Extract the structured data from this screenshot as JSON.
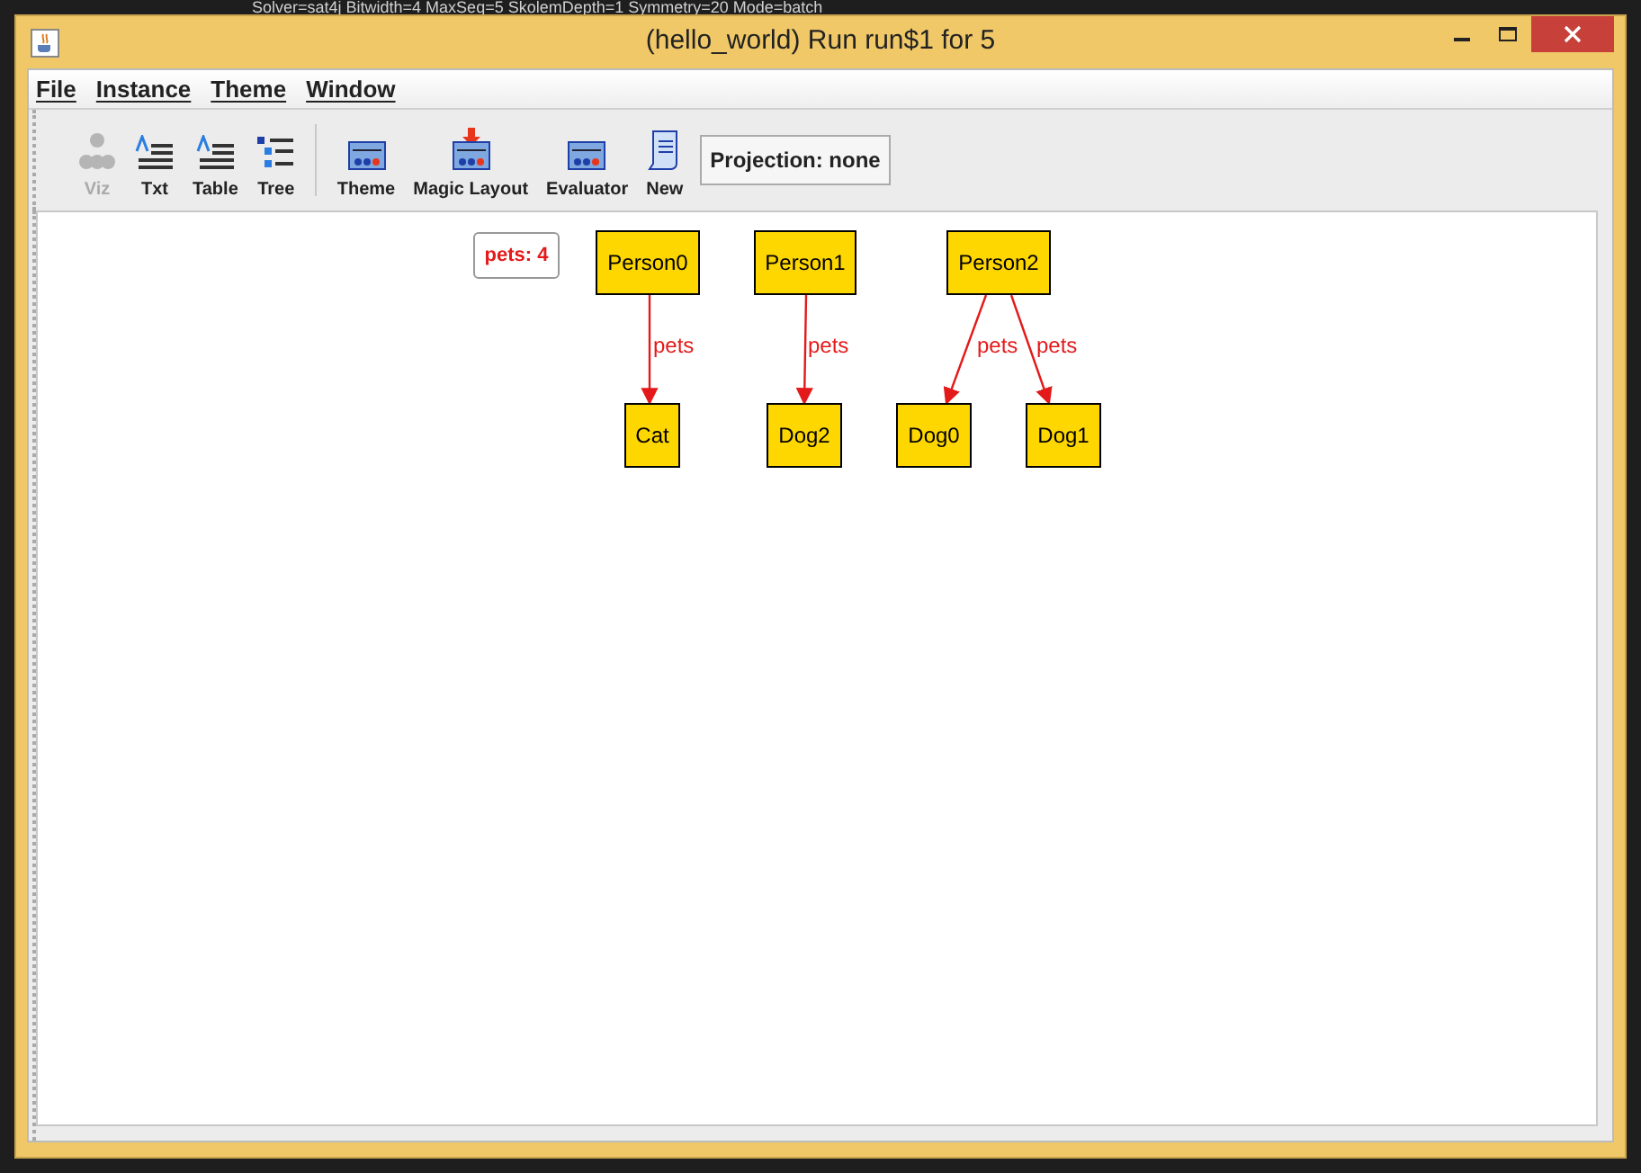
{
  "background_console": {
    "text": "Solver=sat4j Bitwidth=4 MaxSeq=5 SkolemDepth=1 Symmetry=20 Mode=batch"
  },
  "window": {
    "title": "(hello_world) Run run$1 for 5"
  },
  "menu": [
    "File",
    "Instance",
    "Theme",
    "Window"
  ],
  "toolbar": [
    {
      "label": "Viz",
      "kind": "viz",
      "disabled": true
    },
    {
      "label": "Txt",
      "kind": "txt",
      "disabled": false
    },
    {
      "label": "Table",
      "kind": "table",
      "disabled": false
    },
    {
      "label": "Tree",
      "kind": "tree",
      "disabled": false
    },
    {
      "label": "Theme",
      "kind": "panel",
      "disabled": false
    },
    {
      "label": "Magic Layout",
      "kind": "magic",
      "disabled": false
    },
    {
      "label": "Evaluator",
      "kind": "panel",
      "disabled": false
    },
    {
      "label": "New",
      "kind": "scroll",
      "disabled": false
    }
  ],
  "projection": "Projection: none",
  "graph": {
    "legend": "pets: 4",
    "nodes": [
      {
        "label": "Person0",
        "children": [
          {
            "label": "Cat",
            "edge": "pets"
          }
        ]
      },
      {
        "label": "Person1",
        "children": [
          {
            "label": "Dog2",
            "edge": "pets"
          }
        ]
      },
      {
        "label": "Person2",
        "children": [
          {
            "label": "Dog0",
            "edge": "pets"
          },
          {
            "label": "Dog1",
            "edge": "pets"
          }
        ]
      }
    ]
  }
}
